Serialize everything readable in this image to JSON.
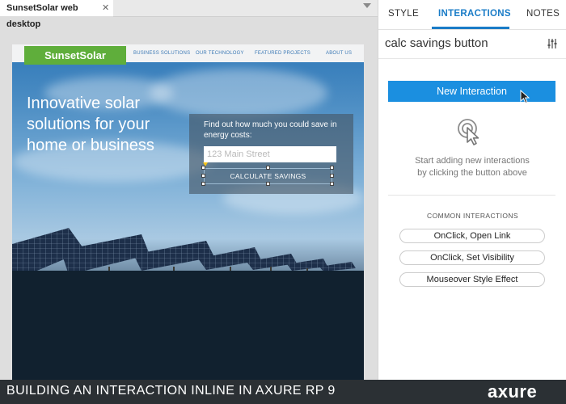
{
  "document_tab": {
    "title": "SunsetSolar web desktop",
    "close": "✕"
  },
  "site": {
    "logo": "SunsetSolar",
    "nav": [
      "BUSINESS SOLUTIONS",
      "OUR TECHNOLOGY",
      "FEATURED PROJECTS",
      "ABOUT US"
    ],
    "hero_title": "Innovative solar solutions for your home or business",
    "form_prompt": "Find out how much you could save in energy costs:",
    "address_placeholder": "123 Main Street",
    "calc_button": "CALCULATE SAVINGS"
  },
  "panel": {
    "tabs": [
      "STYLE",
      "INTERACTIONS",
      "NOTES"
    ],
    "active_tab": "INTERACTIONS",
    "widget_name": "calc savings button",
    "new_interaction_button": "New Interaction",
    "empty_hint": "Start adding new interactions\nby clicking the button above",
    "common_title": "COMMON INTERACTIONS",
    "common_interactions": [
      "OnClick, Open Link",
      "OnClick, Set Visibility",
      "Mouseover Style Effect"
    ]
  },
  "caption": "BUILDING AN INTERACTION INLINE IN AXURE RP 9",
  "brand": "axure",
  "colors": {
    "accent": "#1a7cc7",
    "primary_button": "#1b8fe0",
    "site_logo": "#5fae3b",
    "caption_bar": "#2b3034"
  },
  "icons": [
    "close-icon",
    "tab-menu-icon",
    "settings-sliders-icon",
    "mouse-cursor-icon",
    "click-target-icon"
  ]
}
